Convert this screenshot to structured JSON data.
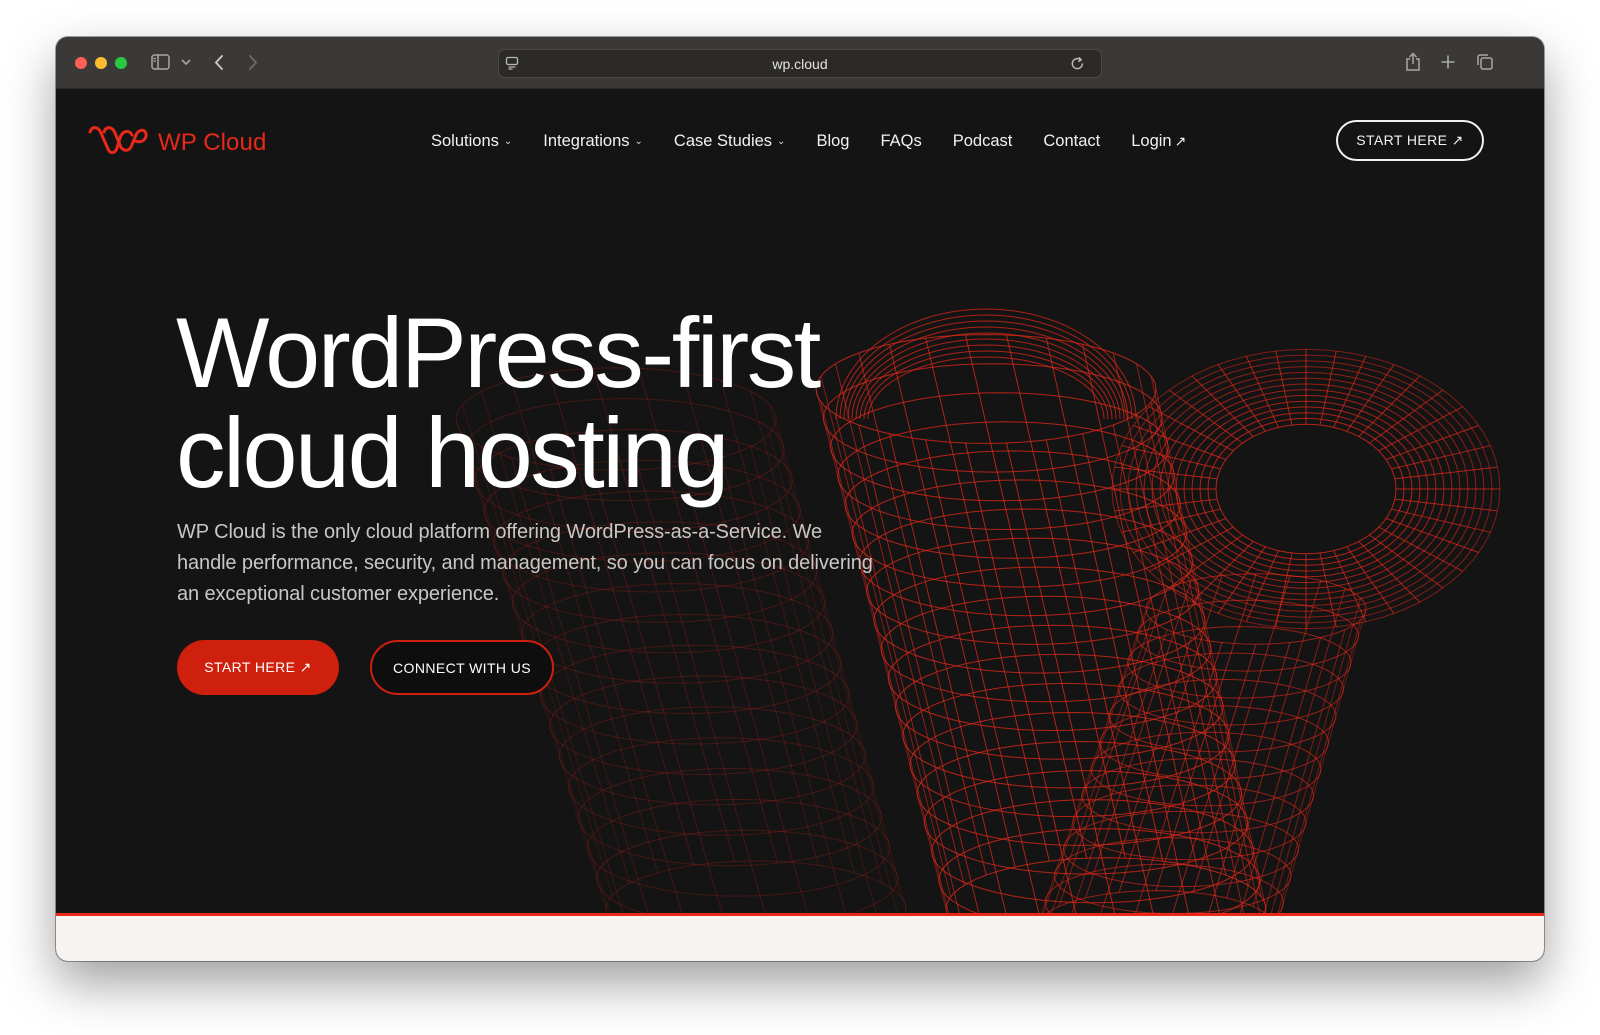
{
  "browser": {
    "url": "wp.cloud",
    "icons": {
      "sidebar": "sidebar-icon",
      "sidebar_menu": "chevron-down-icon",
      "back": "back-arrow-icon",
      "forward": "forward-arrow-icon",
      "page_settings": "page-settings-icon",
      "reload": "reload-icon",
      "share": "share-icon",
      "new_tab": "plus-icon",
      "tab_overview": "tabs-icon"
    }
  },
  "site": {
    "logo_text": "WP Cloud",
    "nav": [
      {
        "label": "Solutions",
        "dropdown": true
      },
      {
        "label": "Integrations",
        "dropdown": true
      },
      {
        "label": "Case Studies",
        "dropdown": true
      },
      {
        "label": "Blog",
        "dropdown": false
      },
      {
        "label": "FAQs",
        "dropdown": false
      },
      {
        "label": "Podcast",
        "dropdown": false
      },
      {
        "label": "Contact",
        "dropdown": false
      },
      {
        "label": "Login",
        "external": true
      }
    ],
    "header_cta": "START HERE ↗",
    "hero": {
      "title_line1": "WordPress-first",
      "title_line2": "cloud hosting",
      "subtitle": "WP Cloud is the only cloud platform offering WordPress-as-a-Service. We handle performance, security, and management, so you can focus on delivering an exceptional customer experience.",
      "primary_cta": "START HERE ↗",
      "secondary_cta": "CONNECT WITH US"
    }
  },
  "colors": {
    "brand_red": "#e8291a",
    "button_red": "#cf1f0d",
    "page_bg": "#151414",
    "strip_bg": "#f7f3f1"
  }
}
